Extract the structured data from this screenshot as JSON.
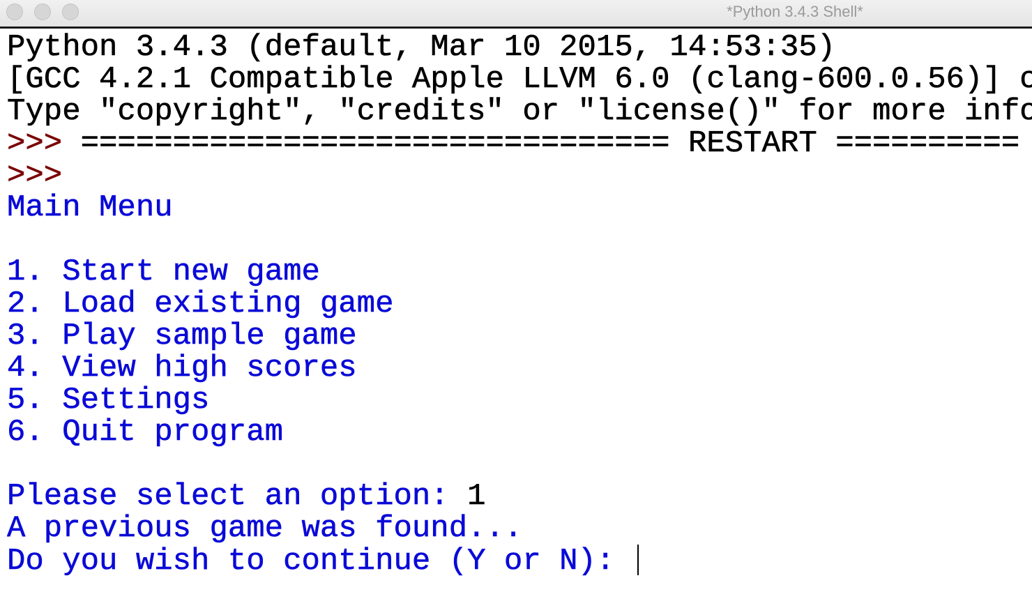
{
  "window": {
    "title": "*Python 3.4.3 Shell*"
  },
  "banner": {
    "line1": "Python 3.4.3 (default, Mar 10 2015, 14:53:35)",
    "line2": "[GCC 4.2.1 Compatible Apple LLVM 6.0 (clang-600.0.56)] c",
    "line3": "Type \"copyright\", \"credits\" or \"license()\" for more info"
  },
  "restart": {
    "prompt": ">>>",
    "text": " ================================ RESTART =========="
  },
  "second_prompt": ">>>",
  "menu": {
    "title": "Main Menu",
    "items": [
      {
        "label": "1. Start new game"
      },
      {
        "label": "2. Load existing game"
      },
      {
        "label": "3. Play sample game"
      },
      {
        "label": "4. View high scores"
      },
      {
        "label": "5. Settings"
      },
      {
        "label": "6. Quit program"
      }
    ]
  },
  "select": {
    "prompt": "Please select an option: ",
    "value": "1"
  },
  "found_message": "A previous game was found...",
  "continue_prompt": {
    "text": "Do you wish to continue (Y or N): ",
    "value": ""
  },
  "colors": {
    "stdout": "#0a0ad8",
    "prompt": "#7a0000",
    "stdin": "#000000"
  }
}
